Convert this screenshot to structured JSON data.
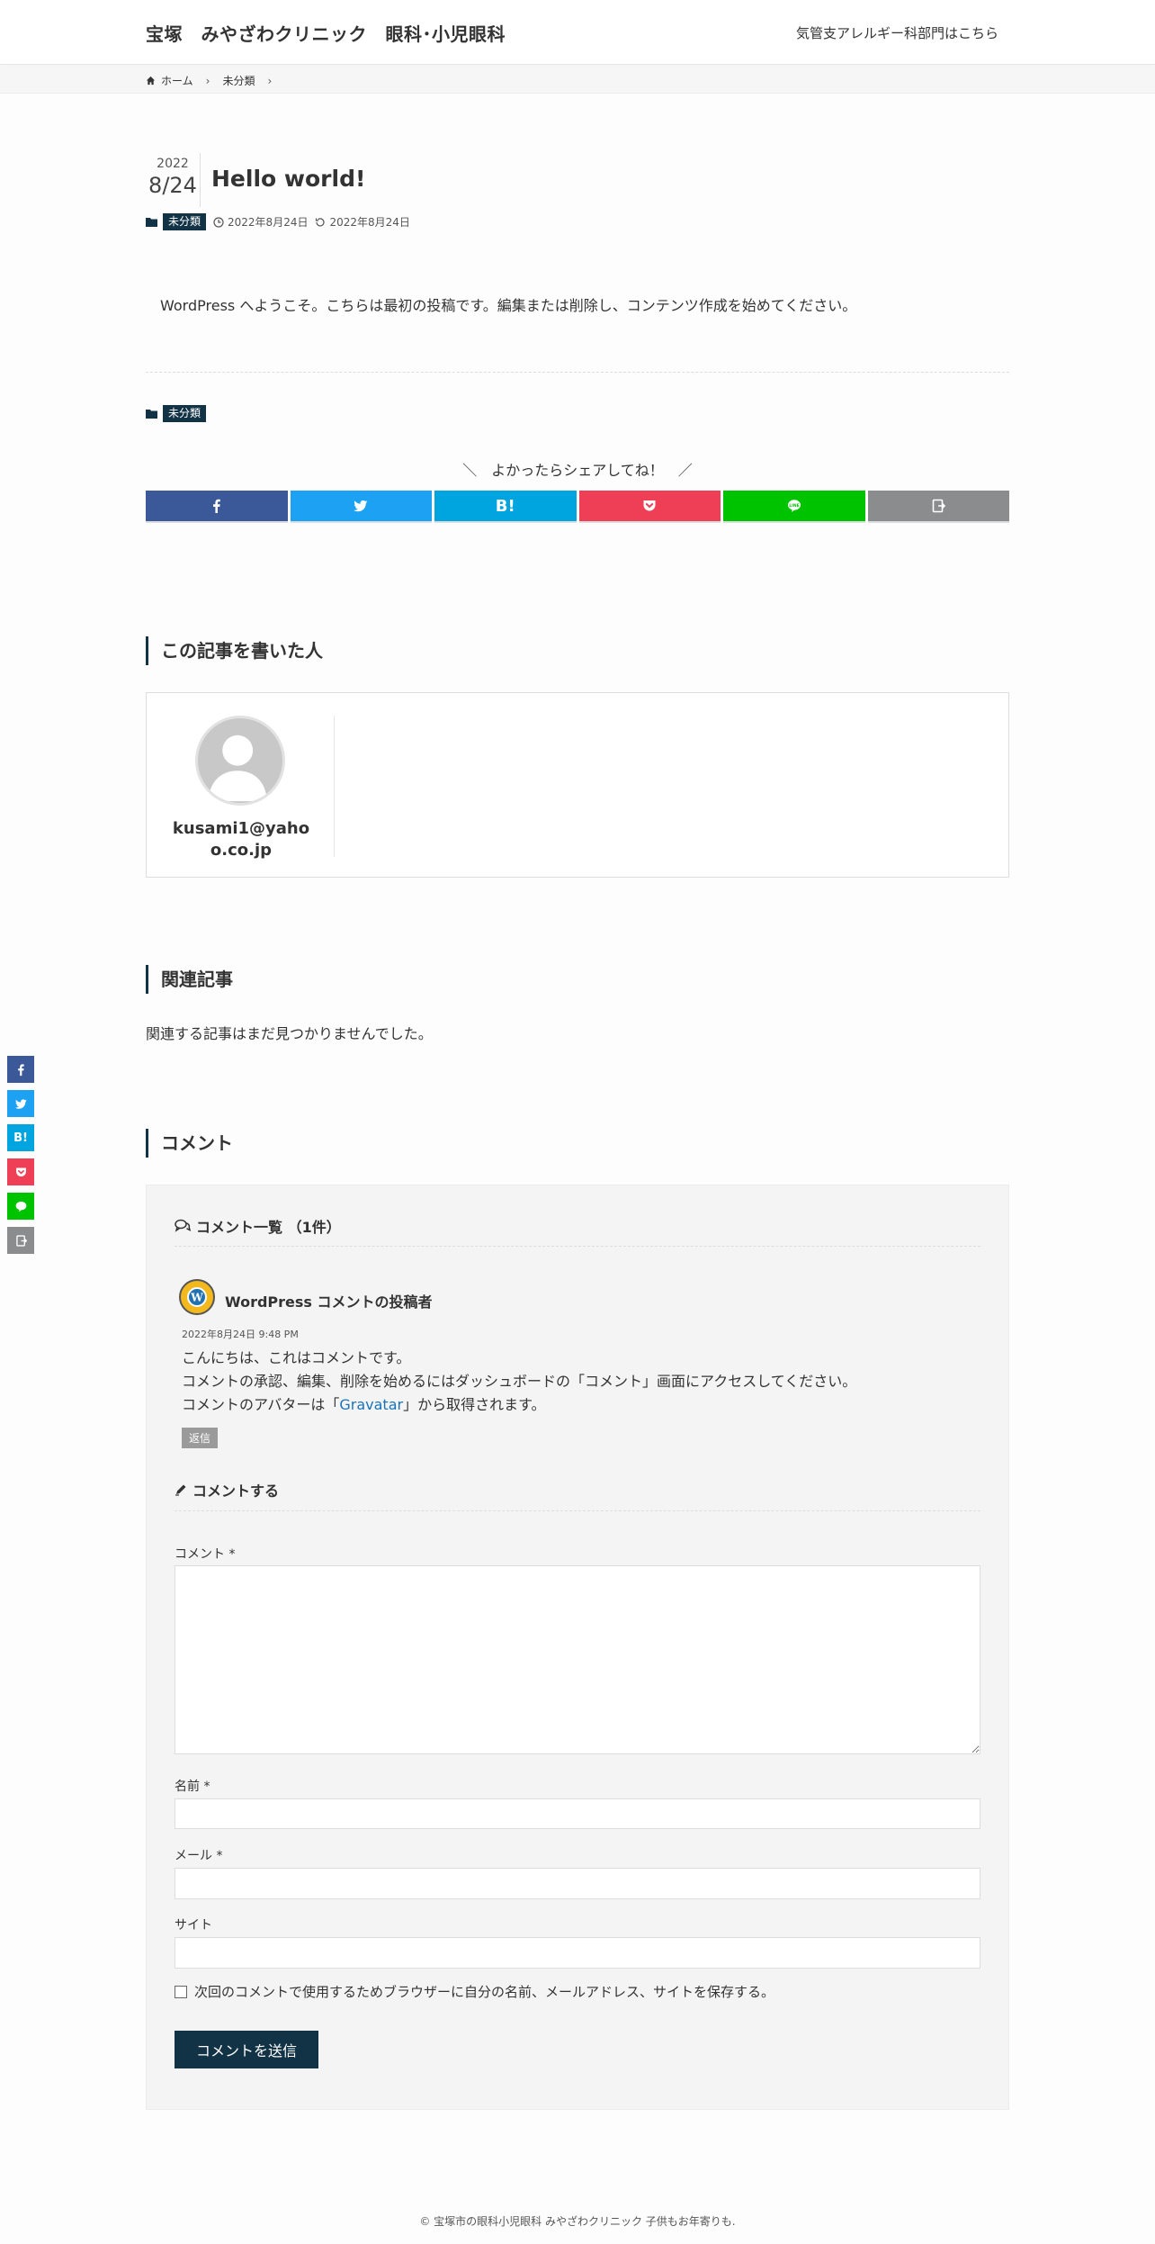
{
  "header": {
    "site_title": "宝塚　みやざわクリニック　眼科･小児眼科",
    "right_link": "気管支アレルギー科部門はこちら"
  },
  "breadcrumb": {
    "home": "ホーム",
    "category": "未分類"
  },
  "post": {
    "year": "2022",
    "month_day": "8/24",
    "title": "Hello world!",
    "category": "未分類",
    "published": "2022年8月24日",
    "updated": "2022年8月24日",
    "content": "WordPress へようこそ。こちらは最初の投稿です。編集または削除し、コンテンツ作成を始めてください。",
    "footer_category": "未分類"
  },
  "share": {
    "heading": "＼　よかったらシェアしてね！　／",
    "buttons": [
      {
        "name": "facebook",
        "color": "#3b5998",
        "icon": "facebook-icon"
      },
      {
        "name": "twitter",
        "color": "#1da1f2",
        "icon": "twitter-icon"
      },
      {
        "name": "hatena",
        "color": "#00a4de",
        "label": "B!"
      },
      {
        "name": "pocket",
        "color": "#ef3f56",
        "icon": "pocket-icon"
      },
      {
        "name": "line",
        "color": "#00c300",
        "icon": "line-icon"
      },
      {
        "name": "copy",
        "color": "#8a8c8e",
        "icon": "copy-icon"
      }
    ]
  },
  "author_section": {
    "heading": "この記事を書いた人",
    "name": "kusami1@yahoo.co.jp"
  },
  "related": {
    "heading": "関連記事",
    "empty_text": "関連する記事はまだ見つかりませんでした。"
  },
  "comments": {
    "heading": "コメント",
    "list_heading": "コメント一覧 （1件）",
    "item": {
      "author": "WordPress コメントの投稿者",
      "date": "2022年8月24日 9:48 PM",
      "line1": "こんにちは、これはコメントです。",
      "line2": "コメントの承認、編集、削除を始めるにはダッシュボードの「コメント」画面にアクセスしてください。",
      "line3_pre": "コメントのアバターは「",
      "line3_link": "Gravatar",
      "line3_post": "」から取得されます。",
      "reply": "返信"
    },
    "form_heading": "コメントする",
    "comment_label": "コメント *",
    "name_label": "名前 *",
    "email_label": "メール *",
    "site_label": "サイト",
    "save_checkbox": "次回のコメントで使用するためブラウザーに自分の名前、メールアドレス、サイトを保存する。",
    "submit": "コメントを送信"
  },
  "footer": {
    "copyright": "© 宝塚市の眼科小児眼科 みやざわクリニック 子供もお年寄りも."
  }
}
